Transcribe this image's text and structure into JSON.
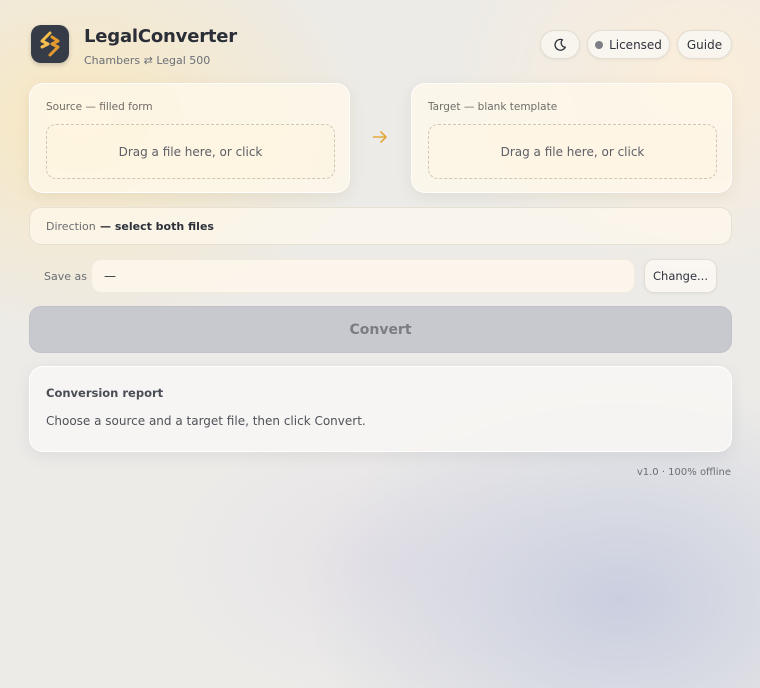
{
  "header": {
    "title": "LegalConverter",
    "subtitle": "Chambers ⇄ Legal 500",
    "theme_icon": "moon-icon",
    "licensed_label": "Licensed",
    "guide_label": "Guide"
  },
  "source": {
    "label": "Source — filled form",
    "dropzone_text": "Drag a file here, or click"
  },
  "target": {
    "label": "Target — blank template",
    "dropzone_text": "Drag a file here, or click"
  },
  "direction": {
    "label": "Direction",
    "value": "— select both files"
  },
  "save_as": {
    "label": "Save as",
    "value": "—",
    "change_label": "Change..."
  },
  "convert": {
    "label": "Convert",
    "disabled": true
  },
  "report": {
    "title": "Conversion report",
    "body": "Choose a source and a target file, then click Convert."
  },
  "footer": {
    "version": "v1.0 · 100% offline"
  },
  "colors": {
    "accent": "#e1a93a",
    "logo_bg": "#353b47",
    "convert_disabled_bg": "#c8c8cf",
    "status_dot": "#7c7f86"
  }
}
